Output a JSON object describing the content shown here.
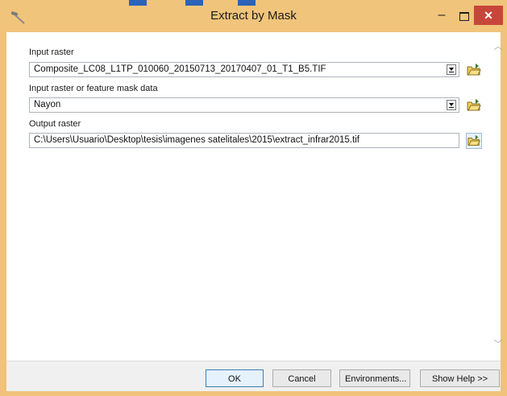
{
  "window": {
    "title": "Extract by Mask",
    "minimize_glyph": "–",
    "close_glyph": "✕",
    "app_icon": "hammer-icon"
  },
  "colors": {
    "titlebar": "#f1c47b",
    "close_button": "#c7463a",
    "field_border": "#aeb3b9",
    "default_button_border": "#3c7fb1"
  },
  "form": {
    "input_raster": {
      "label": "Input raster",
      "value": "Composite_LC08_L1TP_010060_20150713_20170407_01_T1_B5.TIF",
      "control": "combo"
    },
    "mask_data": {
      "label": "Input raster or feature mask data",
      "value": "Nayon",
      "control": "combo"
    },
    "output_raster": {
      "label": "Output raster",
      "value": "C:\\Users\\Usuario\\Desktop\\tesis\\imagenes satelitales\\2015\\extract_infrar2015.tif",
      "control": "text"
    },
    "browse_icon": "open-folder-icon"
  },
  "scrollbar": {
    "up_glyph": "︿",
    "down_glyph": "﹀"
  },
  "buttons": {
    "ok": "OK",
    "cancel": "Cancel",
    "environments": "Environments...",
    "show_help": "Show Help >>"
  }
}
